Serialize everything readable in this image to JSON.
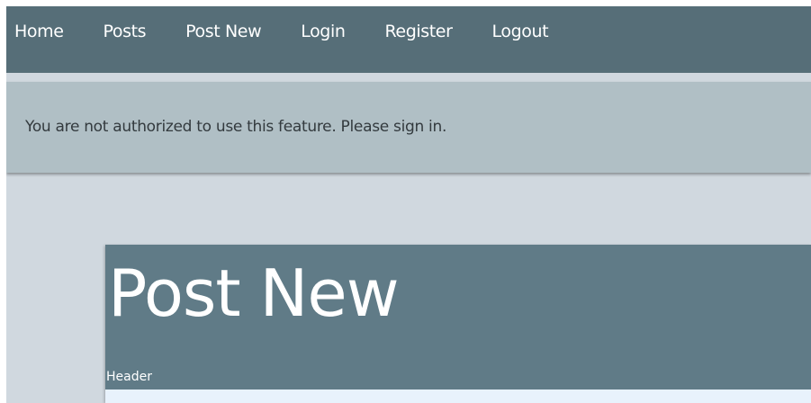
{
  "nav": {
    "items": [
      {
        "label": "Home"
      },
      {
        "label": "Posts"
      },
      {
        "label": "Post New"
      },
      {
        "label": "Login"
      },
      {
        "label": "Register"
      },
      {
        "label": "Logout"
      }
    ]
  },
  "alert": {
    "message": "You are not authorized to use this feature. Please sign in."
  },
  "card": {
    "title": "Post New",
    "subtitle": "Header"
  },
  "colors": {
    "navbar": "#566e78",
    "alert": "#b0bfc5",
    "background": "#d0d8df",
    "card_header": "#607b87",
    "card_body": "#e8f2fc"
  }
}
